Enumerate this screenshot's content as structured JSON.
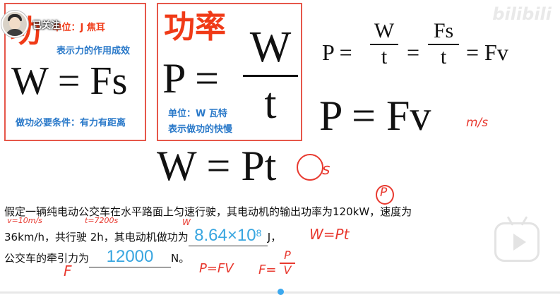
{
  "player": {
    "follow_label": "已关注",
    "watermark": "bilibili",
    "progress_fraction": 0.5
  },
  "work_box": {
    "title": "功",
    "unit": "单位：J 焦耳",
    "meaning": "表示力的作用成效",
    "formula": "W = Fs",
    "condition": "做功必要条件：有力有距离"
  },
  "power_box": {
    "title": "功率",
    "lhs": "P =",
    "numerator": "W",
    "denominator": "t",
    "unit": "单位：W 瓦特",
    "meaning": "表示做功的快慢"
  },
  "formulas": {
    "eq1_lhs": "P =",
    "eq1_f1_num": "W",
    "eq1_f1_den": "t",
    "eq1_eq2": "=",
    "eq1_f2_num": "Fs",
    "eq1_f2_den": "t",
    "eq1_rhs": "= Fv",
    "eq2": "P = Fv",
    "eq3": "W = Pt"
  },
  "annotations": {
    "ms": "m/s",
    "s": "s",
    "p_circle": "P",
    "v10": "v=10m/s",
    "t7200": "t=7200s",
    "w_small": "W",
    "w_pt": "W=Pt",
    "f": "F",
    "p_fv": "P=FV",
    "f_eq": "F=",
    "f_num": "P",
    "f_den": "V"
  },
  "problem": {
    "line1": "假定一辆纯电动公交车在水平路面上匀速行驶，其电动机的输出功率为120kW，速度为",
    "line2_a": "36km/h，共行驶 2h，其电动机做功为",
    "answer1": "8.64×10",
    "answer1_exp": "8",
    "line2_b": "J，",
    "line3_a": "公交车的牵引力为",
    "answer2": "12000",
    "line3_b": "N。"
  },
  "colors": {
    "red": "#f03a17",
    "blue": "#2a79c9",
    "answer_blue": "#39a6e0",
    "ink_red": "#e8392f"
  }
}
